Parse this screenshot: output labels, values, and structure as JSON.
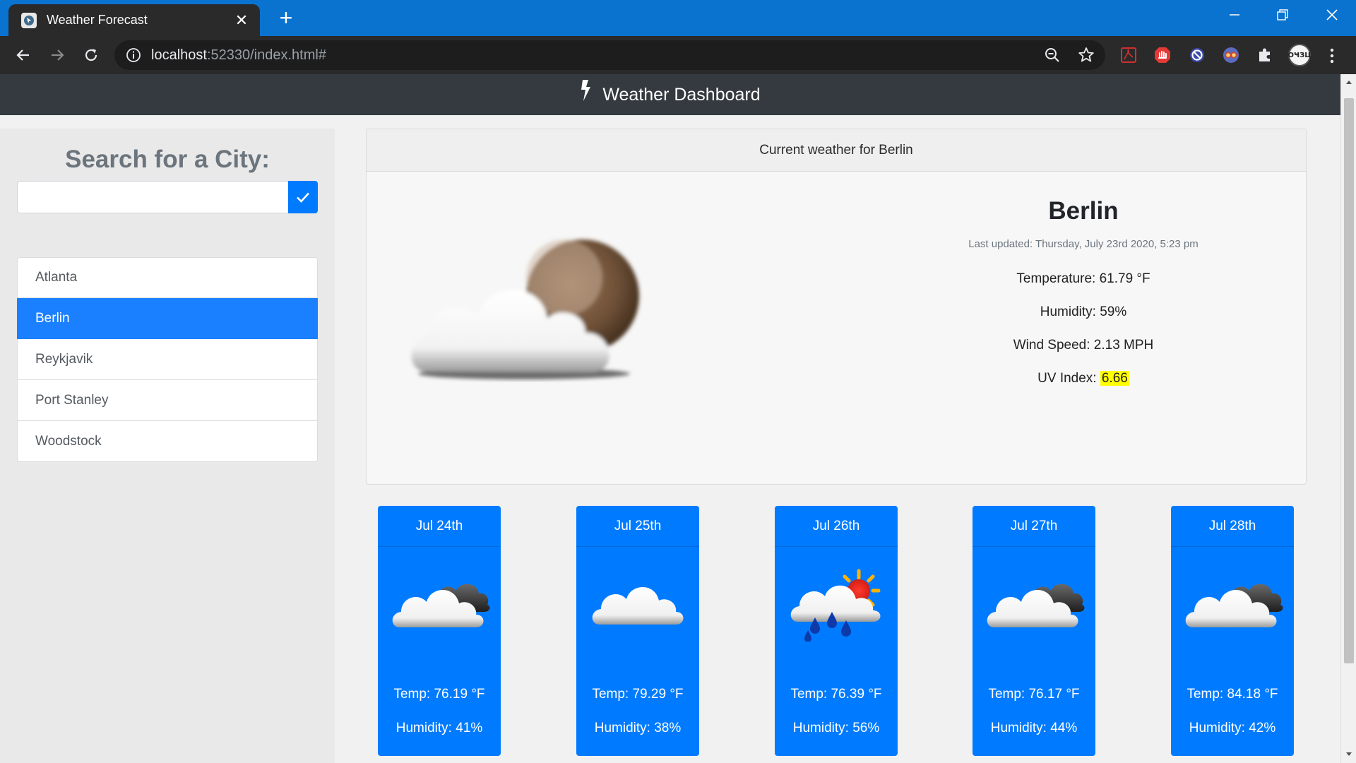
{
  "browser": {
    "tab_title": "Weather Forecast",
    "url_host": "localhost",
    "url_rest": ":52330/index.html#",
    "avatar_text": "ОҸЗЦ"
  },
  "app": {
    "title": "Weather Dashboard"
  },
  "search": {
    "heading": "Search for a City:",
    "value": "",
    "placeholder": ""
  },
  "cities": [
    {
      "name": "Atlanta",
      "active": false
    },
    {
      "name": "Berlin",
      "active": true
    },
    {
      "name": "Reykjavik",
      "active": false
    },
    {
      "name": "Port Stanley",
      "active": false
    },
    {
      "name": "Woodstock",
      "active": false
    }
  ],
  "current": {
    "header": "Current weather for Berlin",
    "city": "Berlin",
    "updated": "Last updated: Thursday, July 23rd 2020, 5:23 pm",
    "temperature": "Temperature: 61.79 °F",
    "humidity": "Humidity: 59%",
    "wind": "Wind Speed: 2.13 MPH",
    "uv_label": "UV Index: ",
    "uv_value": "6.66",
    "icon": "cloud-moon-icon"
  },
  "forecast": [
    {
      "date": "Jul 24th",
      "temp": "Temp: 76.19 °F",
      "humidity": "Humidity: 41%",
      "icon": "cloud-dark-cloud-icon"
    },
    {
      "date": "Jul 25th",
      "temp": "Temp: 79.29 °F",
      "humidity": "Humidity: 38%",
      "icon": "cloud-icon"
    },
    {
      "date": "Jul 26th",
      "temp": "Temp: 76.39 °F",
      "humidity": "Humidity: 56%",
      "icon": "rain-sun-icon"
    },
    {
      "date": "Jul 27th",
      "temp": "Temp: 76.17 °F",
      "humidity": "Humidity: 44%",
      "icon": "cloud-dark-cloud-icon"
    },
    {
      "date": "Jul 28th",
      "temp": "Temp: 84.18 °F",
      "humidity": "Humidity: 42%",
      "icon": "cloud-dark-cloud-icon"
    }
  ],
  "colors": {
    "chrome_titlebar": "#0a73d0",
    "chrome_toolbar": "#2a2a2b",
    "app_header": "#343a40",
    "primary": "#007bff",
    "uv_highlight": "#ffff00"
  }
}
